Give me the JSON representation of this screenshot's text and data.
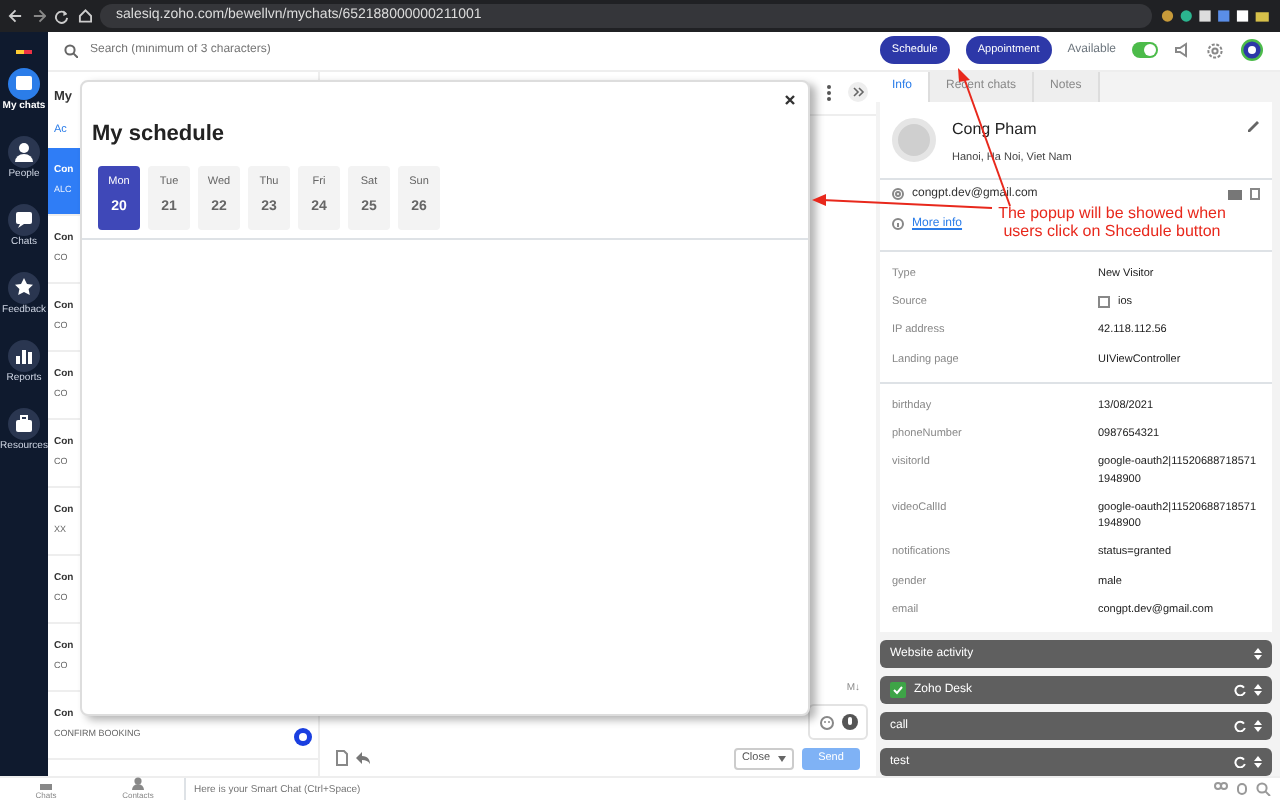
{
  "browser": {
    "url": "salesiq.zoho.com/bewellvn/mychats/652188000000211001"
  },
  "sidebar": {
    "items": [
      {
        "label": "My chats",
        "selected": true
      },
      {
        "label": "People",
        "selected": false
      },
      {
        "label": "Chats",
        "selected": false
      },
      {
        "label": "Feedback",
        "selected": false
      },
      {
        "label": "Reports",
        "selected": false
      },
      {
        "label": "Resources",
        "selected": false
      }
    ]
  },
  "top_bar": {
    "search": {
      "placeholder": "Search (minimum of 3 characters)"
    },
    "buttons": [
      "Schedule",
      "Appointment"
    ],
    "availability": {
      "label": "Available",
      "on": true
    }
  },
  "chat_list": {
    "title": "My",
    "tab": "Ac",
    "items": [
      {
        "title": "Con",
        "subtitle": "ALC",
        "selected": true
      },
      {
        "title": "Con",
        "subtitle": "CO",
        "selected": false
      },
      {
        "title": "Con",
        "subtitle": "CO",
        "selected": false
      },
      {
        "title": "Con",
        "subtitle": "CO",
        "selected": false
      },
      {
        "title": "Con",
        "subtitle": "CO",
        "selected": false
      },
      {
        "title": "Con",
        "subtitle": "XX",
        "selected": false
      },
      {
        "title": "Con",
        "subtitle": "CO",
        "selected": false
      },
      {
        "title": "Con",
        "subtitle": "CO",
        "selected": false
      },
      {
        "title": "Con",
        "subtitle": "CONFIRM BOOKING",
        "selected": false
      }
    ]
  },
  "modal": {
    "title": "My schedule",
    "days": [
      {
        "day": "Mon",
        "date": "20",
        "selected": true
      },
      {
        "day": "Tue",
        "date": "21",
        "selected": false
      },
      {
        "day": "Wed",
        "date": "22",
        "selected": false
      },
      {
        "day": "Thu",
        "date": "23",
        "selected": false
      },
      {
        "day": "Fri",
        "date": "24",
        "selected": false
      },
      {
        "day": "Sat",
        "date": "25",
        "selected": false
      },
      {
        "day": "Sun",
        "date": "26",
        "selected": false
      }
    ]
  },
  "composer": {
    "markdown": "M↓",
    "close_button": "Close",
    "send_button": "Send"
  },
  "contact_panel": {
    "tabs": [
      {
        "label": "Info",
        "selected": true
      },
      {
        "label": "Recent chats",
        "selected": false
      },
      {
        "label": "Notes",
        "selected": false
      }
    ],
    "name": "Cong Pham",
    "location": "Hanoi, Ha Noi, Viet Nam",
    "email": "congpt.dev@gmail.com",
    "more_link": "More info",
    "details": [
      {
        "label": "Type",
        "value": "New Visitor"
      },
      {
        "label": "Source",
        "value": "ios"
      },
      {
        "label": "IP address",
        "value": "42.118.112.56"
      },
      {
        "label": "Landing page",
        "value": "UIViewController"
      }
    ],
    "custom_fields": [
      {
        "label": "birthday",
        "value": "13/08/2021"
      },
      {
        "label": "phoneNumber",
        "value": "0987654321"
      },
      {
        "label": "visitorId",
        "value": "google-oauth2|115206887185711948900"
      },
      {
        "label": "videoCallId",
        "value": "google-oauth2|115206887185711948900"
      },
      {
        "label": "notifications",
        "value": "status=granted"
      },
      {
        "label": "gender",
        "value": "male"
      },
      {
        "label": "email",
        "value": "congpt.dev@gmail.com"
      }
    ],
    "sections": [
      {
        "title": "Website activity",
        "kind": "plain",
        "refresh": false
      },
      {
        "title": "Zoho Desk",
        "kind": "integration",
        "refresh": true
      },
      {
        "title": "call",
        "kind": "plain",
        "refresh": true
      },
      {
        "title": "test",
        "kind": "plain",
        "refresh": true
      }
    ]
  },
  "annotation": {
    "text": "The popup will be showed when users click on Shcedule button"
  },
  "bottom_bar": {
    "items": [
      "Chats",
      "Contacts"
    ],
    "smart_chat": {
      "placeholder": "Here is your Smart Chat (Ctrl+Space)"
    }
  }
}
